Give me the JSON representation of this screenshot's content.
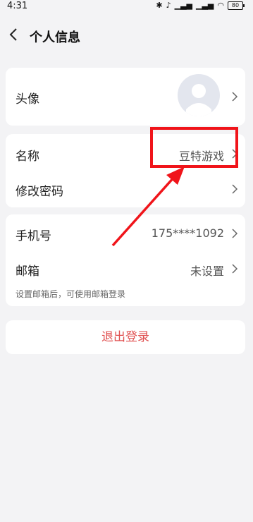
{
  "status_bar": {
    "time": "4:31",
    "battery": "80"
  },
  "header": {
    "title": "个人信息"
  },
  "profile_card": {
    "avatar_label": "头像"
  },
  "account_card": {
    "name_label": "名称",
    "name_value": "豆特游戏",
    "password_label": "修改密码"
  },
  "contact_card": {
    "phone_label": "手机号",
    "phone_value": "175****1092",
    "email_label": "邮箱",
    "email_value": "未设置",
    "email_hint": "设置邮箱后，可使用邮箱登录"
  },
  "logout": {
    "label": "退出登录"
  },
  "colors": {
    "accent_logout": "#e05050",
    "annotation": "#f0141a"
  }
}
